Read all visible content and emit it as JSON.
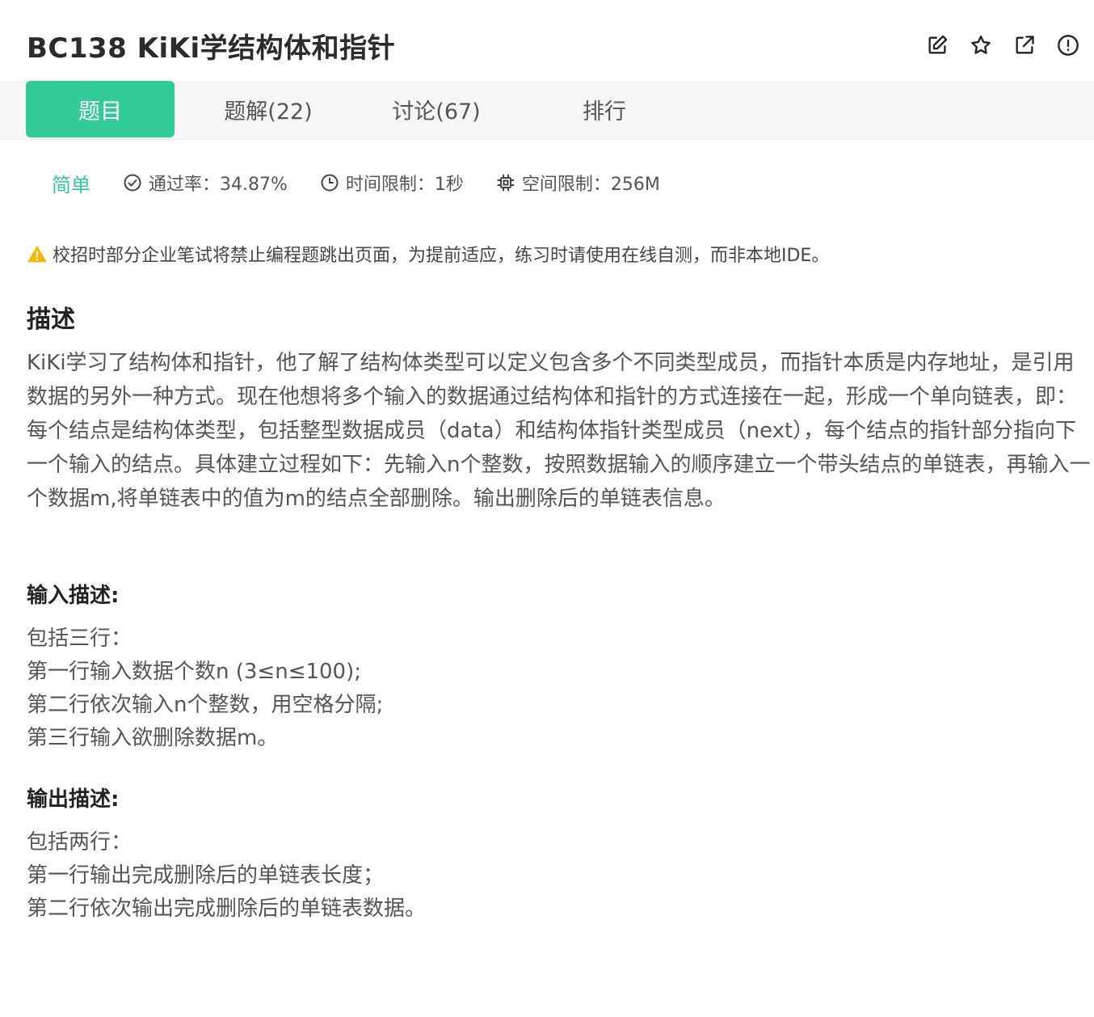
{
  "header": {
    "title": "BC138  KiKi学结构体和指针",
    "icons": [
      "edit-icon",
      "star-icon",
      "external-link-icon",
      "report-icon"
    ]
  },
  "tabs": [
    {
      "label": "题目",
      "active": true
    },
    {
      "label": "题解(22)",
      "active": false
    },
    {
      "label": "讨论(67)",
      "active": false
    },
    {
      "label": "排行",
      "active": false
    }
  ],
  "meta": {
    "difficulty": "简单",
    "pass_rate": "通过率：34.87%",
    "time_limit": "时间限制：1秒",
    "memory_limit": "空间限制：256M"
  },
  "warning": "校招时部分企业笔试将禁止编程题跳出页面，为提前适应，练习时请使用在线自测，而非本地IDE。",
  "description": {
    "title": "描述",
    "text": "KiKi学习了结构体和指针，他了解了结构体类型可以定义包含多个不同类型成员，而指针本质是内存地址，是引用数据的另外一种方式。现在他想将多个输入的数据通过结构体和指针的方式连接在一起，形成一个单向链表，即：每个结点是结构体类型，包括整型数据成员（data）和结构体指针类型成员（next），每个结点的指针部分指向下一个输入的结点。具体建立过程如下：先输入n个整数，按照数据输入的顺序建立一个带头结点的单链表，再输入一个数据m,将单链表中的值为m的结点全部删除。输出删除后的单链表信息。"
  },
  "input_desc": {
    "title": "输入描述:",
    "lines": [
      "包括三行：",
      "第一行输入数据个数n (3≤n≤100);",
      "第二行依次输入n个整数，用空格分隔;",
      "第三行输入欲删除数据m。"
    ]
  },
  "output_desc": {
    "title": "输出描述:",
    "lines": [
      "包括两行：",
      "第一行输出完成删除后的单链表长度；",
      "第二行依次输出完成删除后的单链表数据。"
    ]
  },
  "colors": {
    "accent": "#32ca99",
    "warning": "#f5b800"
  }
}
